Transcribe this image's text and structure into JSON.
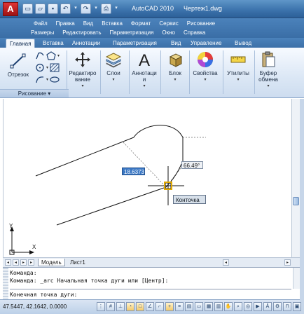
{
  "app": {
    "logo_letter": "A",
    "app_name": "AutoCAD 2010",
    "document_title": "Чертеж1.dwg"
  },
  "quick_access": {
    "icons": [
      "new-icon",
      "open-icon",
      "save-icon",
      "undo-icon",
      "redo-icon",
      "print-icon",
      "dropdown-icon"
    ]
  },
  "menubar": {
    "row1": [
      "Файл",
      "Правка",
      "Вид",
      "Вставка",
      "Формат",
      "Сервис",
      "Рисование"
    ],
    "row2": [
      "Размеры",
      "Редактировать",
      "Параметризация",
      "Окно",
      "Справка"
    ]
  },
  "ribbon": {
    "tabs": [
      "Главная",
      "Вставка",
      "Аннотации",
      "Параметризация",
      "Вид",
      "Управление",
      "Вывод"
    ],
    "active_tab": "Главная",
    "buttons": {
      "line": "Отрезок",
      "edit_line1": "Редактиро",
      "edit_line2": "вание",
      "layers": "Слои",
      "annotations_line1": "Аннотаци",
      "annotations_line2": "и",
      "block": "Блок",
      "properties": "Свойства",
      "utilities": "Утилиты",
      "clipboard_line1": "Буфер",
      "clipboard_line2": "обмена"
    },
    "panel_label": "Рисование ▾"
  },
  "drawing": {
    "dynamic_length": "18.6373",
    "dynamic_angle": "66.49°",
    "snap_tooltip": "Конточка",
    "ucs_y": "Y",
    "ucs_x": "X"
  },
  "layout_tabs": {
    "model": "Модель",
    "sheet1": "Лист1"
  },
  "command_line": {
    "history": [
      "Команда:",
      "Команда: _arc Начальная точка дуги или [Центр]:"
    ],
    "current": "Конечная точка дуги:"
  },
  "statusbar": {
    "coordinates": "47.5447, 42.1642, 0.0000"
  },
  "colors": {
    "titlebar": "#3d74ad",
    "ribbon": "#dbe7f5",
    "dynamic_input_active": "#3b78c4",
    "snap_marker": "#e0a800"
  }
}
